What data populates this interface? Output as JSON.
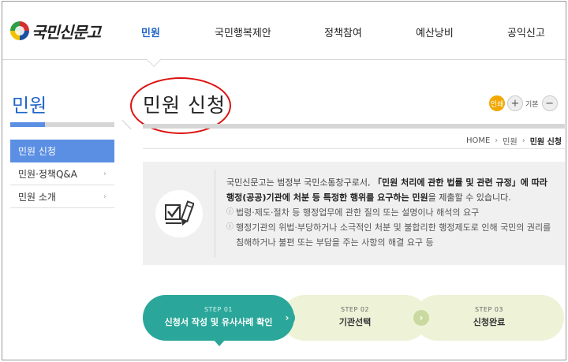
{
  "header": {
    "logo_text": "국민신문고",
    "nav": [
      "민원",
      "국민행복제안",
      "정책참여",
      "예산낭비",
      "공익신고"
    ]
  },
  "sidebar": {
    "title": "민원",
    "progress": 0.33,
    "items": [
      {
        "label": "민원 신청",
        "active": true
      },
      {
        "label": "민원·정책Q&A",
        "active": false
      },
      {
        "label": "민원 소개",
        "active": false
      }
    ]
  },
  "main": {
    "title": "민원 신청",
    "tools": {
      "print": "인쇄",
      "plus": "+",
      "base": "기본",
      "minus": "−"
    },
    "breadcrumb": [
      "HOME",
      "민원",
      "민원 신청"
    ],
    "info": {
      "line1_a": "국민신문고는 범정부 국민소통창구로서, ",
      "line1_b": "「민원 처리에 관한 법률 및 관련 규정」에 따라",
      "line2_a": "행정(공공)기관에 처분 등 특정한 행위를 요구하는 민원",
      "line2_b": "을 제출할 수 있습니다.",
      "bullet1": "법령·제도·절차 등 행정업무에 관한 질의 또는 설명이나 해석의 요구",
      "bullet2": "행정기관의 위법·부당하거나 소극적인 처분 및 불합리한 행정제도로 인해 국민의 권리를 침해하거나 불편 또는 부담을 주는 사항의 해결 요구 등"
    },
    "steps": [
      {
        "num": "STEP 01",
        "label": "신청서 작성 및 유사사례 확인"
      },
      {
        "num": "STEP 02",
        "label": "기관선택"
      },
      {
        "num": "STEP 03",
        "label": "신청완료"
      }
    ],
    "step_arrow": "›"
  },
  "colors": {
    "accent": "#1e64c8",
    "teal": "#2aa79a",
    "annotation": "#dd1111"
  }
}
